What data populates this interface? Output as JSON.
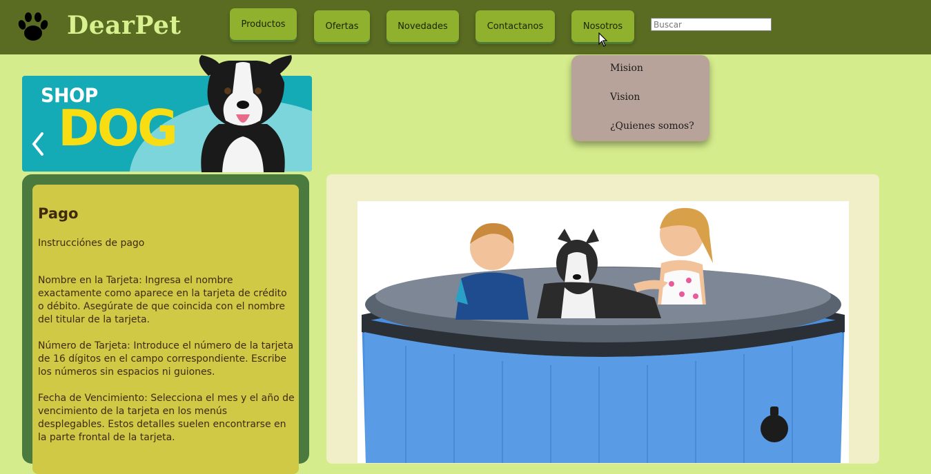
{
  "brand": {
    "name": "DearPet",
    "logo_icon": "paw-icon"
  },
  "nav": {
    "items": [
      {
        "label": "Productos"
      },
      {
        "label": "Ofertas"
      },
      {
        "label": "Novedades"
      },
      {
        "label": "Contactanos"
      },
      {
        "label": "Nosotros"
      }
    ],
    "search_placeholder": "Buscar"
  },
  "dropdown": {
    "items": [
      {
        "label": "Mision"
      },
      {
        "label": "Vision"
      },
      {
        "label": "¿Quienes somos?"
      }
    ]
  },
  "banner": {
    "shop": "SHOP",
    "dog": "DOG",
    "arrow_icon": "chevron-left-icon"
  },
  "payment": {
    "title": "Pago",
    "subtitle": "Instrucciónes de pago",
    "paragraphs": [
      "Nombre en la Tarjeta: Ingresa el nombre exactamente como aparece en la tarjeta de crédito o débito. Asegúrate de que coincida con el nombre del titular de la tarjeta.",
      "Número de Tarjeta: Introduce el número de la tarjeta de 16 dígitos en el campo correspondiente. Escribe los números sin espacios ni guiones.",
      "Fecha de Vencimiento: Selecciona el mes y el año de vencimiento de la tarjeta en los menús desplegables. Estos detalles suelen encontrarse en la parte frontal de la tarjeta."
    ]
  },
  "colors": {
    "header": "#5a6b22",
    "page_bg": "#d5ec8c",
    "nav_button": "#8fb12e",
    "dropdown_bg": "#b8a39b",
    "pay_outer": "#4a7a3e",
    "pay_inner": "#d0c945",
    "product_panel": "#f1efc7"
  }
}
